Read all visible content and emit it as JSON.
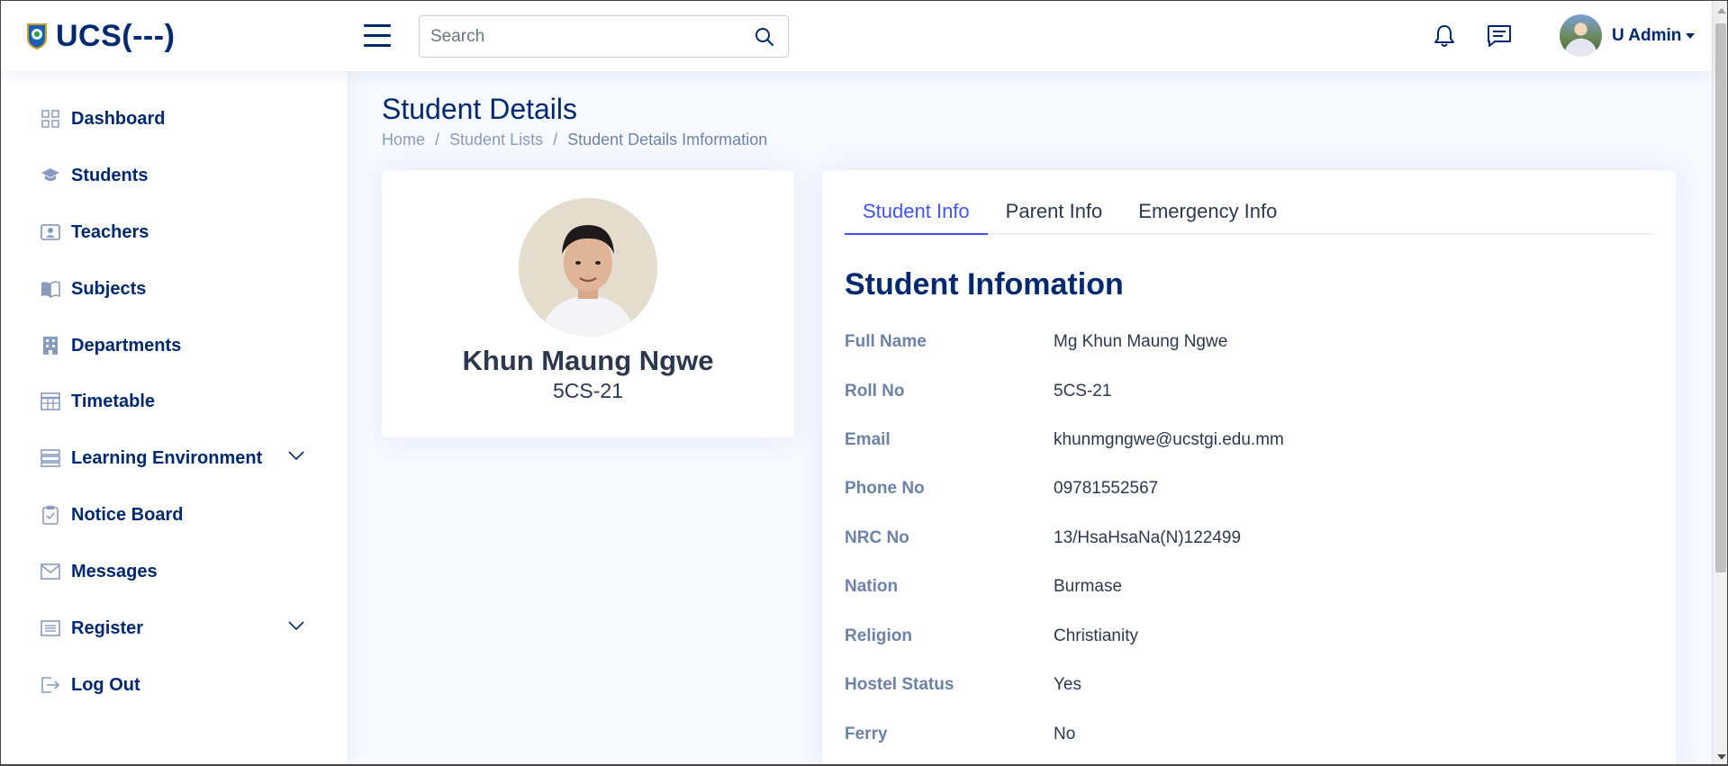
{
  "app": {
    "logo_text": "UCS(---)"
  },
  "header": {
    "search_placeholder": "Search",
    "profile_name": "U Admin"
  },
  "sidebar": {
    "items": [
      {
        "label": "Dashboard",
        "icon": "grid-icon"
      },
      {
        "label": "Students",
        "icon": "graduation-cap-icon"
      },
      {
        "label": "Teachers",
        "icon": "person-badge-icon"
      },
      {
        "label": "Subjects",
        "icon": "book-icon"
      },
      {
        "label": "Departments",
        "icon": "building-icon"
      },
      {
        "label": "Timetable",
        "icon": "table-icon"
      },
      {
        "label": "Learning Environment",
        "icon": "server-icon",
        "expandable": true
      },
      {
        "label": "Notice Board",
        "icon": "clipboard-icon"
      },
      {
        "label": "Messages",
        "icon": "envelope-icon"
      },
      {
        "label": "Register",
        "icon": "list-icon",
        "expandable": true
      },
      {
        "label": "Log Out",
        "icon": "logout-icon"
      }
    ]
  },
  "page": {
    "title": "Student Details",
    "breadcrumb": [
      "Home",
      "Student Lists",
      "Student Details Imformation"
    ]
  },
  "profile": {
    "name": "Khun Maung Ngwe",
    "roll": "5CS-21"
  },
  "tabs": [
    {
      "label": "Student Info",
      "active": true
    },
    {
      "label": "Parent Info",
      "active": false
    },
    {
      "label": "Emergency Info",
      "active": false
    }
  ],
  "info": {
    "title": "Student Infomation",
    "rows": [
      {
        "label": "Full Name",
        "value": "Mg Khun Maung Ngwe"
      },
      {
        "label": "Roll No",
        "value": "5CS-21"
      },
      {
        "label": "Email",
        "value": "khunmgngwe@ucstgi.edu.mm"
      },
      {
        "label": "Phone No",
        "value": "09781552567"
      },
      {
        "label": "NRC No",
        "value": "13/HsaHsaNa(N)122499"
      },
      {
        "label": "Nation",
        "value": "Burmase"
      },
      {
        "label": "Religion",
        "value": "Christianity"
      },
      {
        "label": "Hostel Status",
        "value": "Yes"
      },
      {
        "label": "Ferry",
        "value": "No"
      }
    ]
  },
  "colors": {
    "primary": "#012970",
    "accent": "#4154f1",
    "muted": "#899bbd",
    "background": "#f6f9ff"
  }
}
